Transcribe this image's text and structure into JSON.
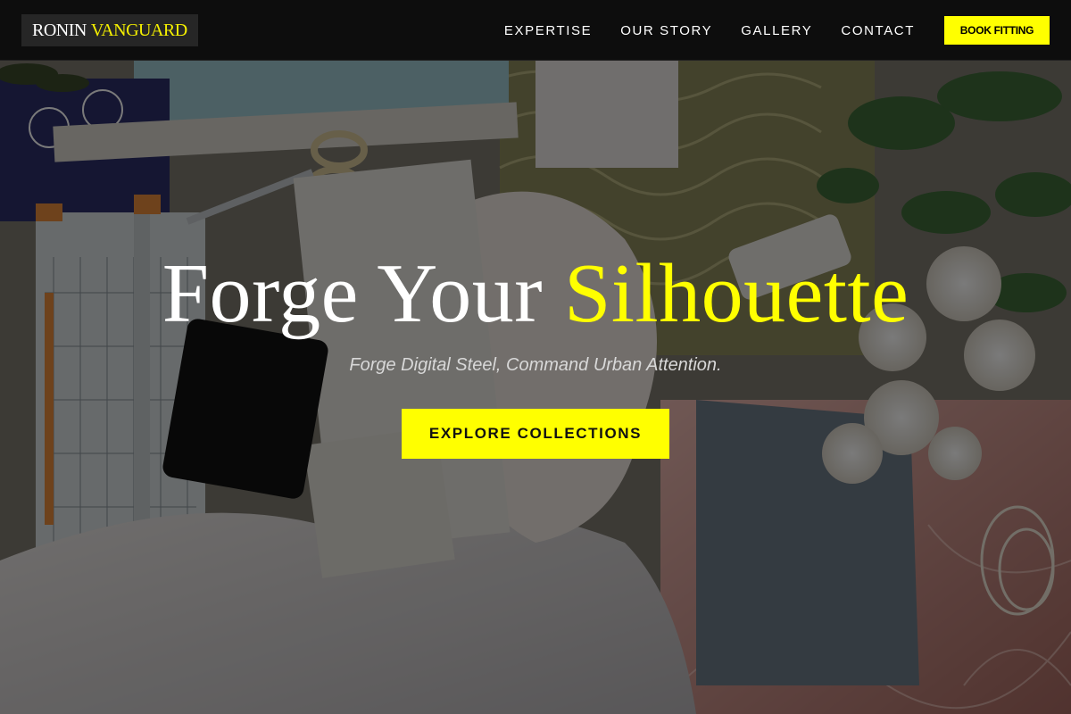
{
  "brand": {
    "name_part1": "RONIN",
    "name_part2": "VANGUARD",
    "accent_color": "#ffff00"
  },
  "nav": {
    "items": [
      {
        "label": "EXPERTISE"
      },
      {
        "label": "OUR STORY"
      },
      {
        "label": "GALLERY"
      },
      {
        "label": "CONTACT"
      }
    ],
    "cta_label": "BOOK FITTING"
  },
  "hero": {
    "headline_part1": "Forge Your",
    "headline_highlight": "Silhouette",
    "tagline": "Forge Digital Steel, Command Urban Attention.",
    "cta_label": "EXPLORE COLLECTIONS",
    "background": "craft-desk-flatlay-photo"
  }
}
